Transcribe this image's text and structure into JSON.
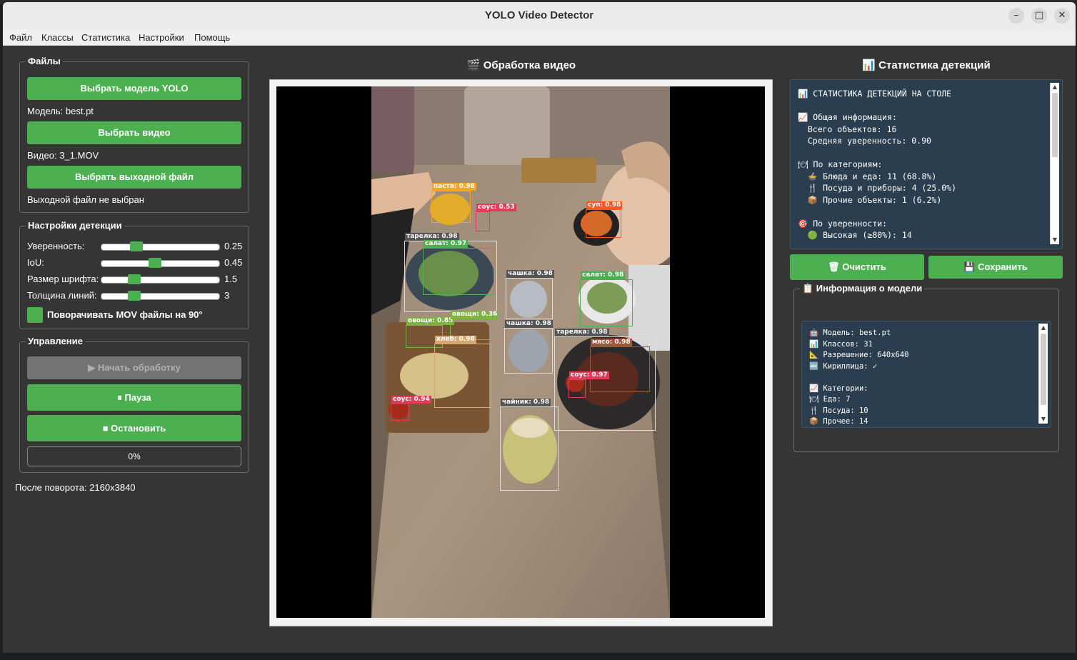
{
  "window": {
    "title": "YOLO Video Detector",
    "controls": {
      "minimize": "–",
      "maximize": "□",
      "close": "✕"
    }
  },
  "menu": [
    "Файл",
    "Классы",
    "Статистика",
    "Настройки",
    "Помощь"
  ],
  "files": {
    "group_title": "Файлы",
    "select_model_label": "Выбрать модель YOLO",
    "model_status": "Модель: best.pt",
    "select_video_label": "Выбрать видео",
    "video_status": "Видео: 3_1.MOV",
    "select_output_label": "Выбрать выходной файл",
    "output_status": "Выходной файл не выбран"
  },
  "detection_settings": {
    "group_title": "Настройки детекции",
    "sliders": [
      {
        "label": "Уверенность:",
        "value": "0.25",
        "position": 0.27
      },
      {
        "label": "IoU:",
        "value": "0.45",
        "position": 0.45
      },
      {
        "label": "Размер шрифта:",
        "value": "1.5",
        "position": 0.25
      },
      {
        "label": "Толщина линий:",
        "value": "3",
        "position": 0.25
      }
    ],
    "rotate_checkbox_label": "Поворачивать MOV файлы на 90°",
    "rotate_checked": true
  },
  "controls": {
    "group_title": "Управление",
    "start_label": "▶ Начать обработку",
    "pause_label": "⏸ Пауза",
    "stop_label": "■ Остановить",
    "progress_text": "0%",
    "progress_value": 0
  },
  "rotation_info": "После поворота: 2160x3840",
  "video_panel": {
    "title": "🎬 Обработка видео",
    "detections": [
      {
        "label": "паста: 0.98",
        "color": "#f5a623"
      },
      {
        "label": "соус: 0.53",
        "color": "#e23b5a"
      },
      {
        "label": "суп: 0.98",
        "color": "#ff5722"
      },
      {
        "label": "тарелка: 0.98",
        "color": "#dddddd"
      },
      {
        "label": "салат: 0.97",
        "color": "#4caf50"
      },
      {
        "label": "чашка: 0.98",
        "color": "#dddddd"
      },
      {
        "label": "салат: 0.98",
        "color": "#4caf50"
      },
      {
        "label": "овощи: 0.85",
        "color": "#7cb342"
      },
      {
        "label": "овощи: 0.36",
        "color": "#7cb342"
      },
      {
        "label": "хлеб: 0.98",
        "color": "#d7a86e"
      },
      {
        "label": "чашка: 0.98",
        "color": "#dddddd"
      },
      {
        "label": "тарелка: 0.98",
        "color": "#dddddd"
      },
      {
        "label": "мясо: 0.98",
        "color": "#a1553a"
      },
      {
        "label": "соус: 0.97",
        "color": "#e23b5a"
      },
      {
        "label": "соус: 0.94",
        "color": "#e23b5a"
      },
      {
        "label": "чайник: 0.98",
        "color": "#dddddd"
      }
    ]
  },
  "stats_panel": {
    "title": "📊 Статистика детекций",
    "lines": [
      "📊 СТАТИСТИКА ДЕТЕКЦИЙ НА СТОЛЕ",
      "",
      "📈 Общая информация:",
      "  Всего объектов: 16",
      "  Средняя уверенность: 0.90",
      "",
      "🍽 По категориям:",
      "  🍲 Блюда и еда: 11 (68.8%)",
      "  🍴 Посуда и приборы: 4 (25.0%)",
      "  📦 Прочие объекты: 1 (6.2%)",
      "",
      "🎯 По уверенности:",
      "  🟢 Высокая (≥80%): 14"
    ],
    "clear_label": "🗑 Очистить",
    "save_label": "💾 Сохранить"
  },
  "model_info": {
    "group_title": "📋 Информация о модели",
    "lines": [
      "🤖 Модель: best.pt",
      "📊 Классов: 31",
      "📐 Разрешение: 640x640",
      "🔤 Кириллица: ✓",
      "",
      "📈 Категории:",
      "🍽 Еда: 7",
      "🍴 Посуда: 10",
      "📦 Прочее: 14"
    ]
  },
  "colors": {
    "accent": "#4caf50",
    "panel_bg": "#353535",
    "text_box_bg": "#2b3e50"
  }
}
